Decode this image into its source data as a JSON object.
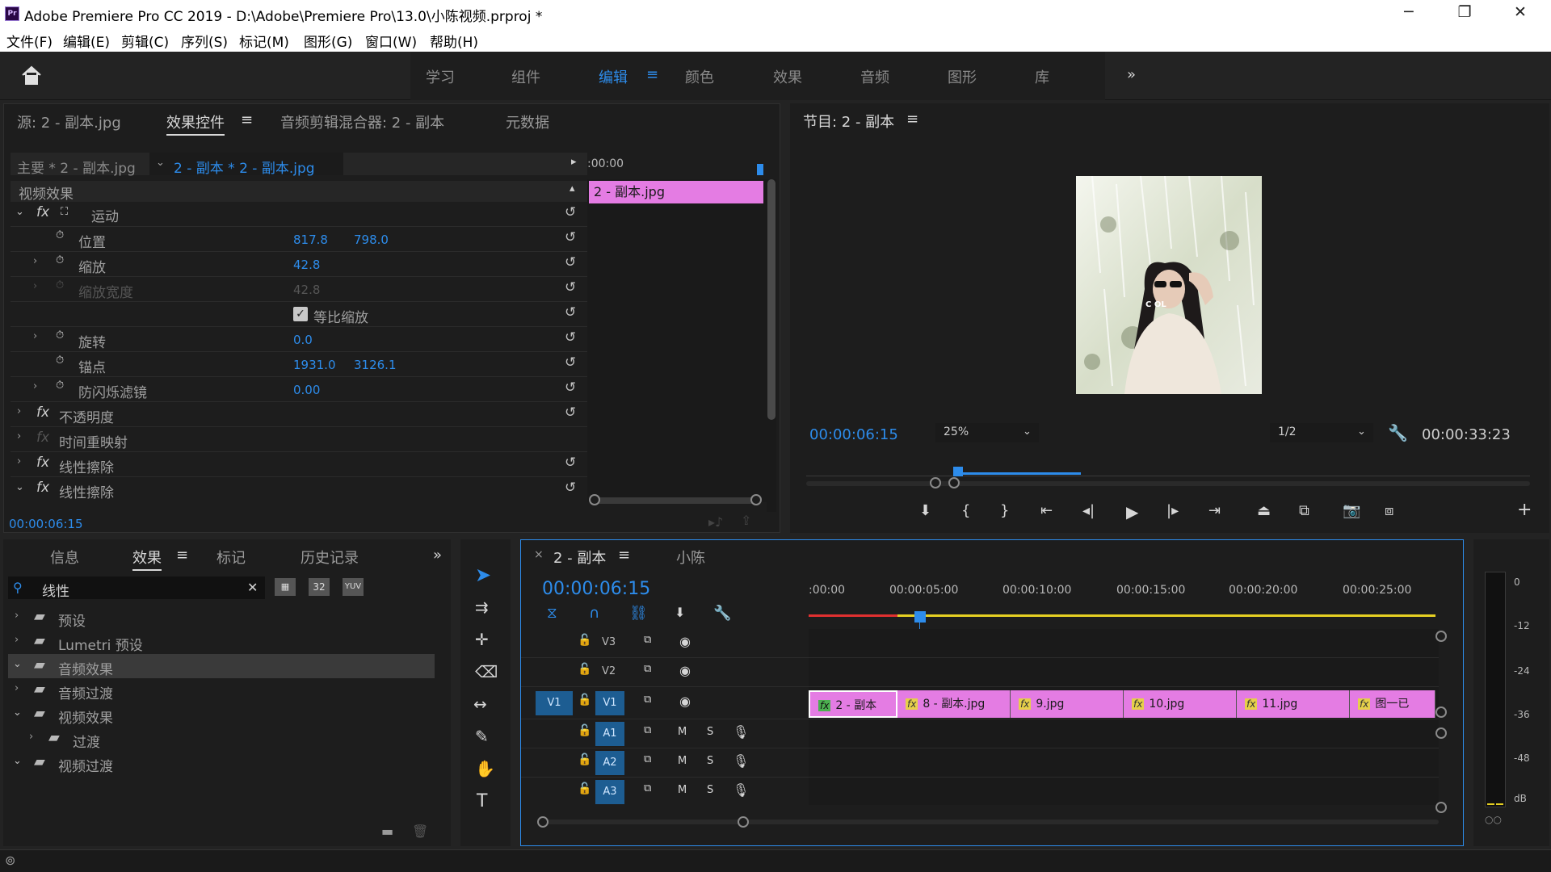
{
  "window": {
    "title": "Adobe Premiere Pro CC 2019 - D:\\Adobe\\Premiere Pro\\13.0\\小陈视频.prproj *",
    "logo": "Pr",
    "minimize": "─",
    "maximize": "❐",
    "close": "✕"
  },
  "menu": [
    "文件(F)",
    "编辑(E)",
    "剪辑(C)",
    "序列(S)",
    "标记(M)",
    "图形(G)",
    "窗口(W)",
    "帮助(H)"
  ],
  "workspaces": {
    "items": [
      "学习",
      "组件",
      "编辑",
      "颜色",
      "效果",
      "音频",
      "图形",
      "库"
    ],
    "active": "编辑",
    "more": "»"
  },
  "source_panel": {
    "tabs": [
      "源: 2 - 副本.jpg",
      "效果控件",
      "音频剪辑混合器: 2 - 副本",
      "元数据"
    ],
    "active_tab": "效果控件",
    "master_label": "主要 * 2 - 副本.jpg",
    "clip_label": "2 - 副本 * 2 - 副本.jpg",
    "mini_time": ":00:00",
    "mini_clip": "2 - 副本.jpg",
    "section": "视频效果",
    "rows": [
      {
        "name": "运动",
        "kind": "fx",
        "v1": "",
        "v2": ""
      },
      {
        "name": "位置",
        "kind": "param",
        "v1": "817.8",
        "v2": "798.0"
      },
      {
        "name": "缩放",
        "kind": "param",
        "v1": "42.8",
        "v2": ""
      },
      {
        "name": "缩放宽度",
        "kind": "param-dim",
        "v1": "42.8",
        "v2": ""
      },
      {
        "name": "等比缩放",
        "kind": "checkbox",
        "v1": "",
        "v2": ""
      },
      {
        "name": "旋转",
        "kind": "param",
        "v1": "0.0",
        "v2": ""
      },
      {
        "name": "锚点",
        "kind": "param",
        "v1": "1931.0",
        "v2": "3126.1"
      },
      {
        "name": "防闪烁滤镜",
        "kind": "param",
        "v1": "0.00",
        "v2": ""
      },
      {
        "name": "不透明度",
        "kind": "fx",
        "v1": "",
        "v2": ""
      },
      {
        "name": "时间重映射",
        "kind": "fx-dim",
        "v1": "",
        "v2": ""
      },
      {
        "name": "线性擦除",
        "kind": "fx",
        "v1": "",
        "v2": ""
      },
      {
        "name": "线性擦除",
        "kind": "fx",
        "v1": "",
        "v2": ""
      }
    ],
    "timecode": "00:00:06:15"
  },
  "program_panel": {
    "title": "节目: 2 - 副本",
    "timecode": "00:00:06:15",
    "zoom": "25%",
    "resolution": "1/2",
    "duration": "00:00:33:23",
    "playhead_fraction": 0.21,
    "overlay_text": "C  OL"
  },
  "effects_panel": {
    "tabs": [
      "信息",
      "效果",
      "标记",
      "历史记录"
    ],
    "active_tab": "效果",
    "search_value": "线性",
    "badges": [
      "32",
      "YUV"
    ],
    "tree": [
      {
        "label": "预设",
        "open": false,
        "indent": 0,
        "selected": false
      },
      {
        "label": "Lumetri 预设",
        "open": false,
        "indent": 0,
        "selected": false
      },
      {
        "label": "音频效果",
        "open": true,
        "indent": 0,
        "selected": true
      },
      {
        "label": "音频过渡",
        "open": false,
        "indent": 0,
        "selected": false
      },
      {
        "label": "视频效果",
        "open": true,
        "indent": 0,
        "selected": false
      },
      {
        "label": "过渡",
        "open": false,
        "indent": 1,
        "selected": false
      },
      {
        "label": "视频过渡",
        "open": true,
        "indent": 0,
        "selected": false
      }
    ]
  },
  "timeline": {
    "tabs": [
      "2 - 副本",
      "小陈"
    ],
    "timecode": "00:00:06:15",
    "ruler": [
      ":00:00",
      "00:00:05:00",
      "00:00:10:00",
      "00:00:15:00",
      "00:00:20:00",
      "00:00:25:00"
    ],
    "tracks": [
      {
        "id": "V3",
        "src": ""
      },
      {
        "id": "V2",
        "src": ""
      },
      {
        "id": "V1",
        "src": "V1"
      },
      {
        "id": "A1",
        "src": ""
      },
      {
        "id": "A2",
        "src": ""
      },
      {
        "id": "A3",
        "src": ""
      }
    ],
    "mute": "M",
    "solo": "S",
    "clips": [
      "2 - 副本",
      "8 - 副本.jpg",
      "9.jpg",
      "10.jpg",
      "11.jpg",
      "图一已"
    ]
  },
  "meter": {
    "labels": [
      "0",
      "-12",
      "-24",
      "-36",
      "-48",
      "dB"
    ]
  }
}
